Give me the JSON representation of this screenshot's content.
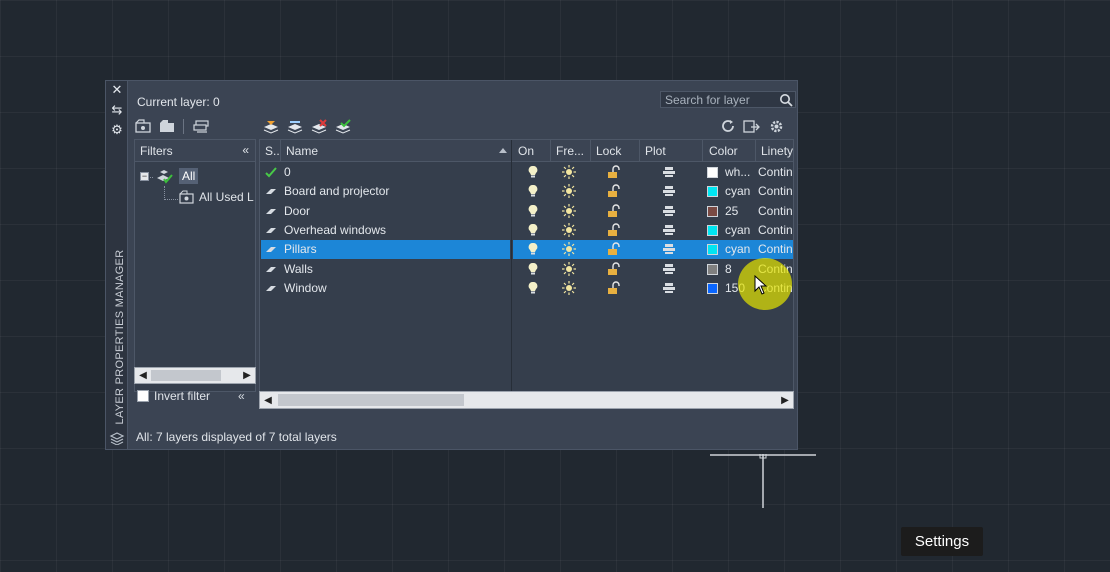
{
  "palette": {
    "side_title": "LAYER PROPERTIES MANAGER",
    "current_layer_label": "Current layer: 0",
    "search_placeholder": "Search for layer",
    "status": "All: 7 layers displayed of 7 total layers"
  },
  "filters": {
    "header": "Filters",
    "collapse_glyph": "«",
    "tree": {
      "all": "All",
      "used": "All Used L"
    },
    "invert_label": "Invert filter"
  },
  "grid": {
    "headers": {
      "status": "S..",
      "name": "Name",
      "on": "On",
      "freeze": "Fre...",
      "lock": "Lock",
      "plot": "Plot",
      "color": "Color",
      "linetype": "Linety"
    },
    "rows": [
      {
        "name": "0",
        "current": true,
        "color_name": "wh...",
        "color_hex": "#ffffff",
        "linetype": "Contin"
      },
      {
        "name": "Board and projector",
        "current": false,
        "color_name": "cyan",
        "color_hex": "#00e5f2",
        "linetype": "Contin"
      },
      {
        "name": "Door",
        "current": false,
        "color_name": "25",
        "color_hex": "#7a4a44",
        "linetype": "Contin"
      },
      {
        "name": "Overhead windows",
        "current": false,
        "color_name": "cyan",
        "color_hex": "#00e5f2",
        "linetype": "Contin"
      },
      {
        "name": "Pillars",
        "current": false,
        "selected": true,
        "color_name": "cyan",
        "color_hex": "#00e5f2",
        "linetype": "Contin"
      },
      {
        "name": "Walls",
        "current": false,
        "color_name": "8",
        "color_hex": "#808080",
        "linetype": "Contin"
      },
      {
        "name": "Window",
        "current": false,
        "color_name": "150",
        "color_hex": "#0a66ff",
        "linetype": "Contin"
      }
    ]
  },
  "tooltip": {
    "settings": "Settings"
  },
  "colors": {
    "accent_selection": "#1c86d7",
    "panel_bg": "#3b4453",
    "canvas_bg": "#212830",
    "cursor_highlight": "#e6e600"
  }
}
